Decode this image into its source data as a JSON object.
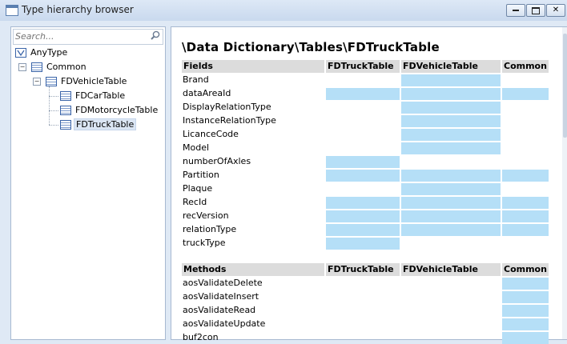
{
  "window": {
    "title": "Type hierarchy browser",
    "minimize_label": "minimize",
    "maximize_label": "maximize",
    "close_label": "close"
  },
  "tree": {
    "search_placeholder": "Search...",
    "nodes": [
      {
        "label": "AnyType",
        "level": 0,
        "selected": false
      },
      {
        "label": "Common",
        "level": 1,
        "selected": false
      },
      {
        "label": "FDVehicleTable",
        "level": 2,
        "selected": false
      },
      {
        "label": "FDCarTable",
        "level": 3,
        "selected": false
      },
      {
        "label": "FDMotorcycleTable",
        "level": 3,
        "selected": false
      },
      {
        "label": "FDTruckTable",
        "level": 3,
        "selected": true
      }
    ]
  },
  "detail": {
    "path": "\\Data Dictionary\\Tables\\FDTruckTable",
    "columns": [
      "FDTruckTable",
      "FDVehicleTable",
      "Common"
    ],
    "fields": {
      "header": "Fields",
      "rows": [
        {
          "name": "Brand",
          "in": [
            false,
            true,
            false
          ]
        },
        {
          "name": "dataAreaId",
          "in": [
            true,
            true,
            true
          ]
        },
        {
          "name": "DisplayRelationType",
          "in": [
            false,
            true,
            false
          ]
        },
        {
          "name": "InstanceRelationType",
          "in": [
            false,
            true,
            false
          ]
        },
        {
          "name": "LicanceCode",
          "in": [
            false,
            true,
            false
          ]
        },
        {
          "name": "Model",
          "in": [
            false,
            true,
            false
          ]
        },
        {
          "name": "numberOfAxles",
          "in": [
            true,
            false,
            false
          ]
        },
        {
          "name": "Partition",
          "in": [
            true,
            true,
            true
          ]
        },
        {
          "name": "Plaque",
          "in": [
            false,
            true,
            false
          ]
        },
        {
          "name": "RecId",
          "in": [
            true,
            true,
            true
          ]
        },
        {
          "name": "recVersion",
          "in": [
            true,
            true,
            true
          ]
        },
        {
          "name": "relationType",
          "in": [
            true,
            true,
            true
          ]
        },
        {
          "name": "truckType",
          "in": [
            true,
            false,
            false
          ]
        }
      ]
    },
    "methods": {
      "header": "Methods",
      "rows": [
        {
          "name": "aosValidateDelete",
          "in": [
            false,
            false,
            true
          ]
        },
        {
          "name": "aosValidateInsert",
          "in": [
            false,
            false,
            true
          ]
        },
        {
          "name": "aosValidateRead",
          "in": [
            false,
            false,
            true
          ]
        },
        {
          "name": "aosValidateUpdate",
          "in": [
            false,
            false,
            true
          ]
        },
        {
          "name": "buf2con",
          "in": [
            false,
            false,
            true
          ]
        }
      ]
    }
  },
  "colors": {
    "member_highlight": "#b5dff7",
    "header_bg": "#dcdcdc",
    "window_bg": "#dfe9f5"
  }
}
